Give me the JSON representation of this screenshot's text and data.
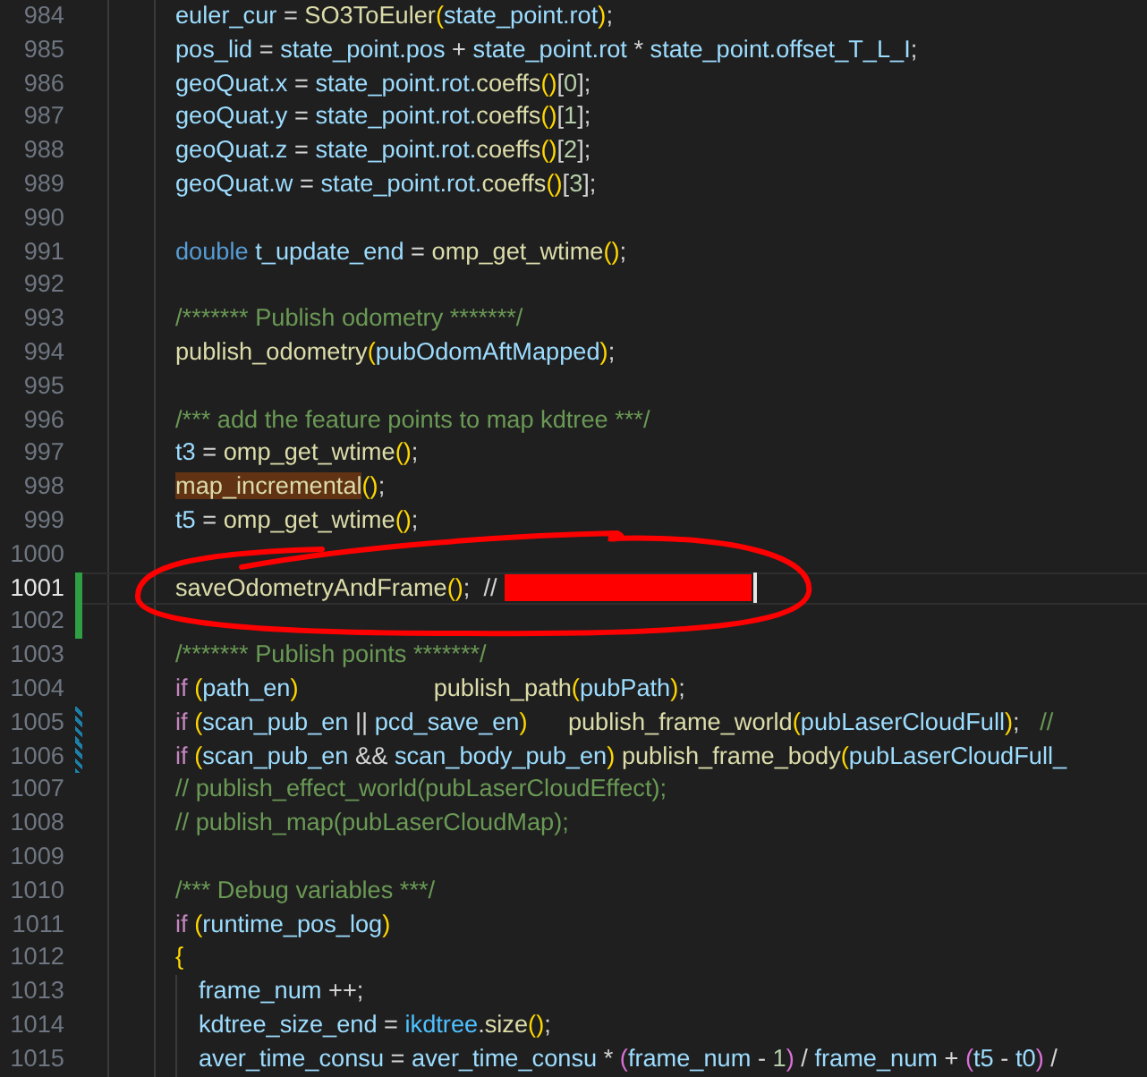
{
  "editor": {
    "lines": [
      {
        "number": "984",
        "tokens": [
          {
            "kind": "variable",
            "text": "euler_cur"
          },
          {
            "kind": "plain",
            "text": " = "
          },
          {
            "kind": "function",
            "text": "SO3ToEuler"
          },
          {
            "kind": "bracket",
            "text": "("
          },
          {
            "kind": "variable",
            "text": "state_point.rot"
          },
          {
            "kind": "bracket",
            "text": ")"
          },
          {
            "kind": "plain",
            "text": ";"
          }
        ]
      },
      {
        "number": "985",
        "tokens": [
          {
            "kind": "variable",
            "text": "pos_lid"
          },
          {
            "kind": "plain",
            "text": " = "
          },
          {
            "kind": "variable",
            "text": "state_point.pos"
          },
          {
            "kind": "plain",
            "text": " + "
          },
          {
            "kind": "variable",
            "text": "state_point.rot"
          },
          {
            "kind": "plain",
            "text": " * "
          },
          {
            "kind": "variable",
            "text": "state_point.offset_T_L_I"
          },
          {
            "kind": "plain",
            "text": ";"
          }
        ]
      },
      {
        "number": "986",
        "tokens": [
          {
            "kind": "variable",
            "text": "geoQuat.x"
          },
          {
            "kind": "plain",
            "text": " = "
          },
          {
            "kind": "variable",
            "text": "state_point.rot."
          },
          {
            "kind": "function",
            "text": "coeffs"
          },
          {
            "kind": "bracket",
            "text": "()"
          },
          {
            "kind": "plain",
            "text": "["
          },
          {
            "kind": "number",
            "text": "0"
          },
          {
            "kind": "plain",
            "text": "];"
          }
        ]
      },
      {
        "number": "987",
        "tokens": [
          {
            "kind": "variable",
            "text": "geoQuat.y"
          },
          {
            "kind": "plain",
            "text": " = "
          },
          {
            "kind": "variable",
            "text": "state_point.rot."
          },
          {
            "kind": "function",
            "text": "coeffs"
          },
          {
            "kind": "bracket",
            "text": "()"
          },
          {
            "kind": "plain",
            "text": "["
          },
          {
            "kind": "number",
            "text": "1"
          },
          {
            "kind": "plain",
            "text": "];"
          }
        ]
      },
      {
        "number": "988",
        "tokens": [
          {
            "kind": "variable",
            "text": "geoQuat.z"
          },
          {
            "kind": "plain",
            "text": " = "
          },
          {
            "kind": "variable",
            "text": "state_point.rot."
          },
          {
            "kind": "function",
            "text": "coeffs"
          },
          {
            "kind": "bracket",
            "text": "()"
          },
          {
            "kind": "plain",
            "text": "["
          },
          {
            "kind": "number",
            "text": "2"
          },
          {
            "kind": "plain",
            "text": "];"
          }
        ]
      },
      {
        "number": "989",
        "tokens": [
          {
            "kind": "variable",
            "text": "geoQuat.w"
          },
          {
            "kind": "plain",
            "text": " = "
          },
          {
            "kind": "variable",
            "text": "state_point.rot."
          },
          {
            "kind": "function",
            "text": "coeffs"
          },
          {
            "kind": "bracket",
            "text": "()"
          },
          {
            "kind": "plain",
            "text": "["
          },
          {
            "kind": "number",
            "text": "3"
          },
          {
            "kind": "plain",
            "text": "];"
          }
        ]
      },
      {
        "number": "990"
      },
      {
        "number": "991",
        "tokens": [
          {
            "kind": "keyword",
            "text": "double "
          },
          {
            "kind": "variable",
            "text": "t_update_end"
          },
          {
            "kind": "plain",
            "text": " = "
          },
          {
            "kind": "function",
            "text": "omp_get_wtime"
          },
          {
            "kind": "bracket",
            "text": "()"
          },
          {
            "kind": "plain",
            "text": ";"
          }
        ]
      },
      {
        "number": "992"
      },
      {
        "number": "993",
        "tokens": [
          {
            "kind": "comment",
            "text": "/******* Publish odometry *******/"
          }
        ]
      },
      {
        "number": "994",
        "tokens": [
          {
            "kind": "function",
            "text": "publish_odometry"
          },
          {
            "kind": "bracket",
            "text": "("
          },
          {
            "kind": "variable",
            "text": "pubOdomAftMapped"
          },
          {
            "kind": "bracket",
            "text": ")"
          },
          {
            "kind": "plain",
            "text": ";"
          }
        ]
      },
      {
        "number": "995"
      },
      {
        "number": "996",
        "tokens": [
          {
            "kind": "comment",
            "text": "/*** add the feature points to map kdtree ***/"
          }
        ]
      },
      {
        "number": "997",
        "tokens": [
          {
            "kind": "variable",
            "text": "t3"
          },
          {
            "kind": "plain",
            "text": " = "
          },
          {
            "kind": "function",
            "text": "omp_get_wtime"
          },
          {
            "kind": "bracket",
            "text": "()"
          },
          {
            "kind": "plain",
            "text": ";"
          }
        ]
      },
      {
        "number": "998",
        "tokens": [
          {
            "kind": "highlight",
            "text": "map_incremental"
          },
          {
            "kind": "bracket",
            "text": "()"
          },
          {
            "kind": "plain",
            "text": ";"
          }
        ]
      },
      {
        "number": "999",
        "tokens": [
          {
            "kind": "variable",
            "text": "t5"
          },
          {
            "kind": "plain",
            "text": " = "
          },
          {
            "kind": "function",
            "text": "omp_get_wtime"
          },
          {
            "kind": "bracket",
            "text": "()"
          },
          {
            "kind": "plain",
            "text": ";"
          }
        ]
      },
      {
        "number": "1000"
      },
      {
        "number": "1001",
        "active": true,
        "added": true,
        "redacted": true,
        "cursor": true,
        "tokens": [
          {
            "kind": "function",
            "text": "saveOdometryAndFrame"
          },
          {
            "kind": "bracket",
            "text": "()"
          },
          {
            "kind": "plain",
            "text": ";  //"
          }
        ]
      },
      {
        "number": "1002",
        "added": true
      },
      {
        "number": "1003",
        "tokens": [
          {
            "kind": "comment",
            "text": "/******* Publish points *******/"
          }
        ]
      },
      {
        "number": "1004",
        "tokens": [
          {
            "kind": "control",
            "text": "if "
          },
          {
            "kind": "bracket",
            "text": "("
          },
          {
            "kind": "variable",
            "text": "path_en"
          },
          {
            "kind": "bracket",
            "text": ")                    "
          },
          {
            "kind": "function",
            "text": "publish_path"
          },
          {
            "kind": "bracket",
            "text": "("
          },
          {
            "kind": "variable",
            "text": "pubPath"
          },
          {
            "kind": "bracket",
            "text": ")"
          },
          {
            "kind": "plain",
            "text": ";"
          }
        ]
      },
      {
        "number": "1005",
        "modified": true,
        "tokens": [
          {
            "kind": "control",
            "text": "if "
          },
          {
            "kind": "bracket",
            "text": "("
          },
          {
            "kind": "variable",
            "text": "scan_pub_en"
          },
          {
            "kind": "plain",
            "text": " || "
          },
          {
            "kind": "variable",
            "text": "pcd_save_en"
          },
          {
            "kind": "bracket",
            "text": ")      "
          },
          {
            "kind": "function",
            "text": "publish_frame_world"
          },
          {
            "kind": "bracket",
            "text": "("
          },
          {
            "kind": "variable",
            "text": "pubLaserCloudFull"
          },
          {
            "kind": "bracket",
            "text": ")"
          },
          {
            "kind": "plain",
            "text": ";   "
          },
          {
            "kind": "comment",
            "text": "//"
          }
        ]
      },
      {
        "number": "1006",
        "modified": true,
        "tokens": [
          {
            "kind": "control",
            "text": "if "
          },
          {
            "kind": "bracket",
            "text": "("
          },
          {
            "kind": "variable",
            "text": "scan_pub_en"
          },
          {
            "kind": "plain",
            "text": " && "
          },
          {
            "kind": "variable",
            "text": "scan_body_pub_en"
          },
          {
            "kind": "bracket",
            "text": ") "
          },
          {
            "kind": "function",
            "text": "publish_frame_body"
          },
          {
            "kind": "bracket",
            "text": "("
          },
          {
            "kind": "variable",
            "text": "pubLaserCloudFull_"
          }
        ]
      },
      {
        "number": "1007",
        "tokens": [
          {
            "kind": "comment",
            "text": "// publish_effect_world(pubLaserCloudEffect);"
          }
        ]
      },
      {
        "number": "1008",
        "tokens": [
          {
            "kind": "comment",
            "text": "// publish_map(pubLaserCloudMap);"
          }
        ]
      },
      {
        "number": "1009"
      },
      {
        "number": "1010",
        "tokens": [
          {
            "kind": "comment",
            "text": "/*** Debug variables ***/"
          }
        ]
      },
      {
        "number": "1011",
        "tokens": [
          {
            "kind": "control",
            "text": "if "
          },
          {
            "kind": "bracket",
            "text": "("
          },
          {
            "kind": "variable",
            "text": "runtime_pos_log"
          },
          {
            "kind": "bracket",
            "text": ")"
          }
        ]
      },
      {
        "number": "1012",
        "tokens": [
          {
            "kind": "bracket",
            "text": "{"
          }
        ],
        "children": [
          {
            "number": "1013",
            "tokens": [
              {
                "kind": "variable",
                "text": "frame_num"
              },
              {
                "kind": "plain",
                "text": " ++;"
              }
            ]
          },
          {
            "number": "1014",
            "tokens": [
              {
                "kind": "variable",
                "text": "kdtree_size_end"
              },
              {
                "kind": "plain",
                "text": " = "
              },
              {
                "kind": "type",
                "text": "ikdtree"
              },
              {
                "kind": "plain",
                "text": "."
              },
              {
                "kind": "function",
                "text": "size"
              },
              {
                "kind": "bracket",
                "text": "()"
              },
              {
                "kind": "plain",
                "text": ";"
              }
            ]
          },
          {
            "number": "1015",
            "tokens": [
              {
                "kind": "variable",
                "text": "aver_time_consu"
              },
              {
                "kind": "plain",
                "text": " = "
              },
              {
                "kind": "variable",
                "text": "aver_time_consu"
              },
              {
                "kind": "plain",
                "text": " * "
              },
              {
                "kind": "bracket2",
                "text": "("
              },
              {
                "kind": "variable",
                "text": "frame_num"
              },
              {
                "kind": "plain",
                "text": " - "
              },
              {
                "kind": "number",
                "text": "1"
              },
              {
                "kind": "bracket2",
                "text": ")"
              },
              {
                "kind": "plain",
                "text": " / "
              },
              {
                "kind": "variable",
                "text": "frame_num"
              },
              {
                "kind": "plain",
                "text": " + "
              },
              {
                "kind": "bracket2",
                "text": "("
              },
              {
                "kind": "variable",
                "text": "t5"
              },
              {
                "kind": "plain",
                "text": " - "
              },
              {
                "kind": "variable",
                "text": "t0"
              },
              {
                "kind": "bracket2",
                "text": ")"
              },
              {
                "kind": "plain",
                "text": " /"
              }
            ]
          }
        ]
      }
    ],
    "annotation": {
      "kind": "ellipse",
      "color": "#ff0000"
    }
  }
}
